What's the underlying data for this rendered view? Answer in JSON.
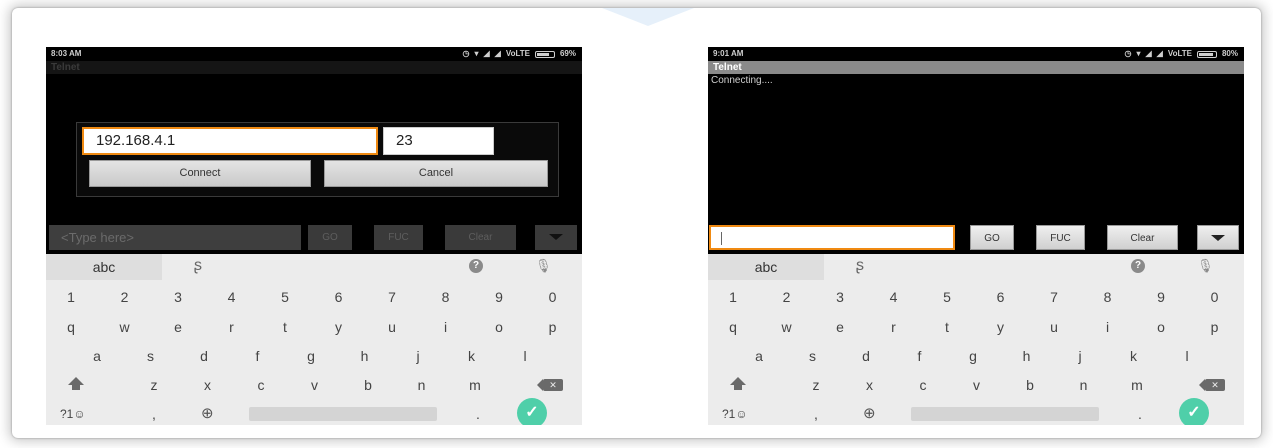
{
  "phones": [
    {
      "status": {
        "time": "8:03 AM",
        "carrier": "VoLTE",
        "battery": "69%",
        "battery_level": 0.69
      },
      "title": "Telnet",
      "dialog": {
        "ip": "192.168.4.1",
        "port": "23",
        "connect_label": "Connect",
        "cancel_label": "Cancel"
      },
      "input": {
        "placeholder": "<Type here>"
      },
      "buttons": {
        "go": "GO",
        "fuc": "FUC",
        "clear": "Clear"
      }
    },
    {
      "status": {
        "time": "9:01 AM",
        "carrier": "VoLTE",
        "battery": "80%",
        "battery_level": 0.8
      },
      "title": "Telnet",
      "console": "Connecting....",
      "input": {
        "placeholder": ""
      },
      "buttons": {
        "go": "GO",
        "fuc": "FUC",
        "clear": "Clear"
      }
    }
  ],
  "keyboard": {
    "mode_label": "abc",
    "numbers": [
      "1",
      "2",
      "3",
      "4",
      "5",
      "6",
      "7",
      "8",
      "9",
      "0"
    ],
    "row1": [
      "q",
      "w",
      "e",
      "r",
      "t",
      "y",
      "u",
      "i",
      "o",
      "p"
    ],
    "row2": [
      "a",
      "s",
      "d",
      "f",
      "g",
      "h",
      "j",
      "k",
      "l"
    ],
    "row3": [
      "z",
      "x",
      "c",
      "v",
      "b",
      "n",
      "m"
    ],
    "symbols_label": "?1☺",
    "comma": ",",
    "period": "."
  },
  "icons": {
    "status": [
      "alarm-icon",
      "wifi-icon",
      "signal-icon",
      "battery-icon"
    ],
    "keyboard": [
      "handwriting-icon",
      "help-icon",
      "mic-icon",
      "shift-icon",
      "backspace-icon",
      "globe-icon",
      "enter-check-icon"
    ],
    "menu": "dropdown-arrow-icon"
  },
  "colors": {
    "accent_orange": "#f08a12",
    "enter_green": "#4fcfa9"
  }
}
